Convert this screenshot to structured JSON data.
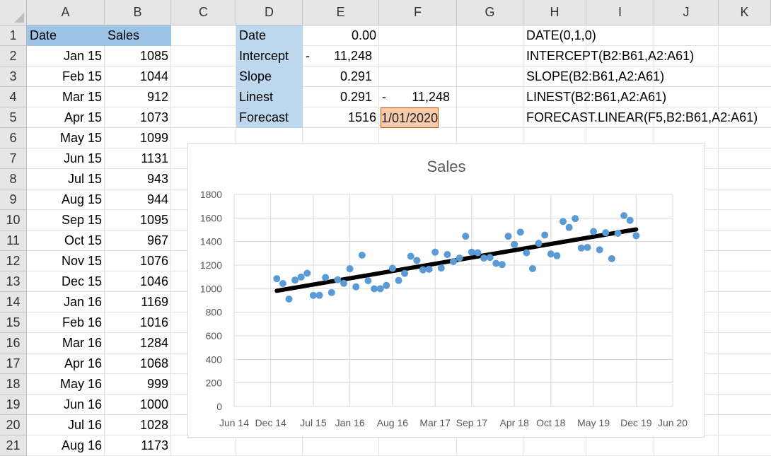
{
  "columns": [
    "A",
    "B",
    "C",
    "D",
    "E",
    "F",
    "G",
    "H",
    "I",
    "J",
    "K"
  ],
  "rows": [
    "1",
    "2",
    "3",
    "4",
    "5",
    "6",
    "7",
    "8",
    "9",
    "10",
    "11",
    "12",
    "13",
    "14",
    "15",
    "16",
    "17",
    "18",
    "19",
    "20",
    "21"
  ],
  "table": {
    "header_date": "Date",
    "header_sales": "Sales",
    "dates": [
      "Jan 15",
      "Feb 15",
      "Mar 15",
      "Apr 15",
      "May 15",
      "Jun 15",
      "Jul 15",
      "Aug 15",
      "Sep 15",
      "Oct 15",
      "Nov 15",
      "Dec 15",
      "Jan 16",
      "Feb 16",
      "Mar 16",
      "Apr 16",
      "May 16",
      "Jun 16",
      "Jul 16",
      "Aug 16"
    ],
    "sales": [
      "1085",
      "1044",
      "912",
      "1073",
      "1099",
      "1131",
      "943",
      "944",
      "1095",
      "967",
      "1076",
      "1046",
      "1169",
      "1016",
      "1284",
      "1068",
      "999",
      "1000",
      "1028",
      "1173"
    ]
  },
  "stats": {
    "labels": [
      "Date",
      "Intercept",
      "Slope",
      "Linest",
      "Forecast"
    ],
    "e_values": [
      "0.00",
      "11,248",
      "0.291",
      "0.291",
      "1516"
    ],
    "intercept_prefix": "-",
    "linest_f_prefix": "-",
    "linest_f_value": "11,248",
    "forecast_date": "1/01/2020",
    "formulas": [
      "DATE(0,1,0)",
      "INTERCEPT(B2:B61,A2:A61)",
      "SLOPE(B2:B61,A2:A61)",
      "LINEST(B2:B61,A2:A61)",
      "FORECAST.LINEAR(F5,B2:B61,A2:A61)"
    ]
  },
  "colors": {
    "point": "#5b9bd5",
    "trend": "#000000",
    "header_blue": "#9dc3e6",
    "label_blue": "#bdd7ee",
    "forecast_orange": "#f8cbad"
  },
  "chart_data": {
    "type": "scatter",
    "title": "Sales",
    "xlabel": "",
    "ylabel": "",
    "ylim": [
      0,
      1800
    ],
    "yticks": [
      "0",
      "200",
      "400",
      "600",
      "800",
      "1000",
      "1200",
      "1400",
      "1600",
      "1800"
    ],
    "xticks": [
      "Jun 14",
      "Dec 14",
      "Jul 15",
      "Jan 16",
      "Aug 16",
      "Mar 17",
      "Sep 17",
      "Apr 18",
      "Oct 18",
      "May 19",
      "Dec 19",
      "Jun 20"
    ],
    "grid": true,
    "legend": "none",
    "x": [
      "Jan 15",
      "Feb 15",
      "Mar 15",
      "Apr 15",
      "May 15",
      "Jun 15",
      "Jul 15",
      "Aug 15",
      "Sep 15",
      "Oct 15",
      "Nov 15",
      "Dec 15",
      "Jan 16",
      "Feb 16",
      "Mar 16",
      "Apr 16",
      "May 16",
      "Jun 16",
      "Jul 16",
      "Aug 16",
      "Sep 16",
      "Oct 16",
      "Nov 16",
      "Dec 16",
      "Jan 17",
      "Feb 17",
      "Mar 17",
      "Apr 17",
      "May 17",
      "Jun 17",
      "Jul 17",
      "Aug 17",
      "Sep 17",
      "Oct 17",
      "Nov 17",
      "Dec 17",
      "Jan 18",
      "Feb 18",
      "Mar 18",
      "Apr 18",
      "May 18",
      "Jun 18",
      "Jul 18",
      "Aug 18",
      "Sep 18",
      "Oct 18",
      "Nov 18",
      "Dec 18",
      "Jan 19",
      "Feb 19",
      "Mar 19",
      "Apr 19",
      "May 19",
      "Jun 19",
      "Jul 19",
      "Aug 19",
      "Sep 19",
      "Oct 19",
      "Nov 19",
      "Dec 19"
    ],
    "values": [
      1085,
      1044,
      912,
      1073,
      1099,
      1131,
      943,
      944,
      1095,
      967,
      1076,
      1046,
      1169,
      1016,
      1284,
      1068,
      999,
      1000,
      1028,
      1173,
      1070,
      1130,
      1275,
      1240,
      1160,
      1165,
      1310,
      1175,
      1290,
      1230,
      1260,
      1445,
      1310,
      1305,
      1260,
      1265,
      1215,
      1205,
      1445,
      1375,
      1480,
      1305,
      1170,
      1385,
      1455,
      1295,
      1280,
      1570,
      1520,
      1595,
      1345,
      1350,
      1485,
      1330,
      1475,
      1255,
      1470,
      1620,
      1580,
      1450
    ],
    "trendline": {
      "x": [
        "Jan 15",
        "Dec 19"
      ],
      "values": [
        982,
        1503
      ]
    }
  }
}
